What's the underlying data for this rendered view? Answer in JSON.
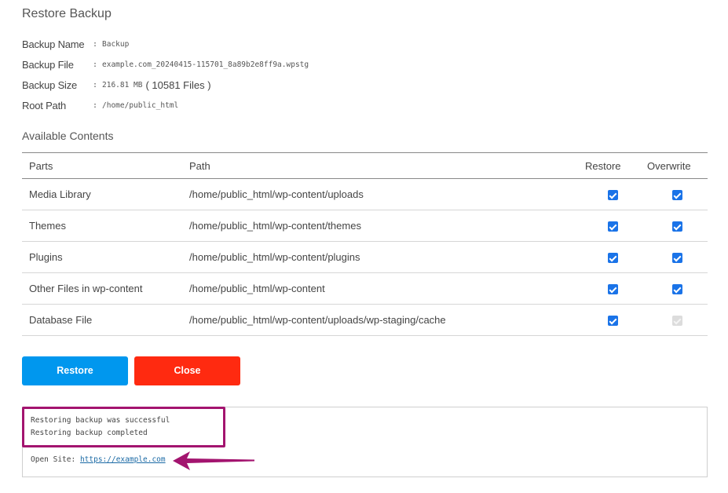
{
  "title": "Restore Backup",
  "meta": {
    "separator": ":",
    "rows": [
      {
        "label": "Backup Name",
        "value": "Backup",
        "extra": ""
      },
      {
        "label": "Backup File",
        "value": "example.com_20240415-115701_8a89b2e8ff9a.wpstg",
        "extra": ""
      },
      {
        "label": "Backup Size",
        "value": "216.81 MB",
        "extra": "( 10581 Files )"
      },
      {
        "label": "Root Path",
        "value": "/home/public_html",
        "extra": ""
      }
    ]
  },
  "contents": {
    "title": "Available Contents",
    "headers": {
      "parts": "Parts",
      "path": "Path",
      "restore": "Restore",
      "overwrite": "Overwrite"
    },
    "rows": [
      {
        "part": "Media Library",
        "path": "/home/public_html/wp-content/uploads",
        "restore": true,
        "overwrite": true,
        "overwrite_disabled": false
      },
      {
        "part": "Themes",
        "path": "/home/public_html/wp-content/themes",
        "restore": true,
        "overwrite": true,
        "overwrite_disabled": false
      },
      {
        "part": "Plugins",
        "path": "/home/public_html/wp-content/plugins",
        "restore": true,
        "overwrite": true,
        "overwrite_disabled": false
      },
      {
        "part": "Other Files in wp-content",
        "path": "/home/public_html/wp-content",
        "restore": true,
        "overwrite": true,
        "overwrite_disabled": false
      },
      {
        "part": "Database File",
        "path": "/home/public_html/wp-content/uploads/wp-staging/cache",
        "restore": true,
        "overwrite": true,
        "overwrite_disabled": true
      }
    ]
  },
  "buttons": {
    "restore": "Restore",
    "close": "Close"
  },
  "colors": {
    "restore_button": "#0097ee",
    "close_button": "#ff2a10",
    "checkbox": "#1a73e8",
    "annotation": "#a3146f"
  },
  "log": {
    "lines": [
      "Restoring backup was successful",
      "Restoring backup completed"
    ],
    "open_site_label": "Open Site:",
    "open_site_url": "https://example.com"
  }
}
